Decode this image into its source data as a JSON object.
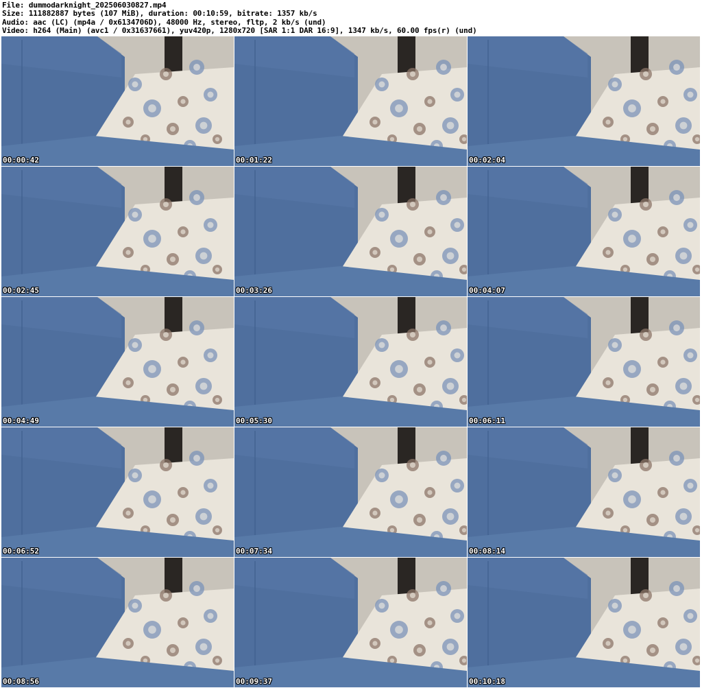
{
  "header": {
    "file_line": "File: dummodarknight_202506030827.mp4",
    "size_line": "Size: 111882887 bytes (107 MiB), duration: 00:10:59, bitrate: 1357 kb/s",
    "audio_line": "Audio: aac (LC) (mp4a / 0x6134706D), 48000 Hz, stereo, fltp, 2 kb/s (und)",
    "video_line": "Video: h264 (Main) (avc1 / 0x31637661), yuv420p, 1280x720 [SAR 1:1 DAR 16:9], 1347 kb/s, 60.00 fps(r) (und)"
  },
  "thumbnails": [
    {
      "timestamp": "00:00:42",
      "variant": "a"
    },
    {
      "timestamp": "00:01:22",
      "variant": "b"
    },
    {
      "timestamp": "00:02:04",
      "variant": "b"
    },
    {
      "timestamp": "00:02:45",
      "variant": "a"
    },
    {
      "timestamp": "00:03:26",
      "variant": "b"
    },
    {
      "timestamp": "00:04:07",
      "variant": "b"
    },
    {
      "timestamp": "00:04:49",
      "variant": "a"
    },
    {
      "timestamp": "00:05:30",
      "variant": "b"
    },
    {
      "timestamp": "00:06:11",
      "variant": "b"
    },
    {
      "timestamp": "00:06:52",
      "variant": "a"
    },
    {
      "timestamp": "00:07:34",
      "variant": "b"
    },
    {
      "timestamp": "00:08:14",
      "variant": "b"
    },
    {
      "timestamp": "00:08:56",
      "variant": "a"
    },
    {
      "timestamp": "00:09:37",
      "variant": "b"
    },
    {
      "timestamp": "00:10:18",
      "variant": "b"
    }
  ],
  "colors": {
    "wall": "#c8c3ba",
    "sofa_back": "#4f6f9e",
    "sofa_seat": "#587aa8",
    "pillow": "#e9e4da",
    "flower_blue": "#7b93b8",
    "flower_brown": "#8c7568",
    "post": "#2a2623"
  }
}
